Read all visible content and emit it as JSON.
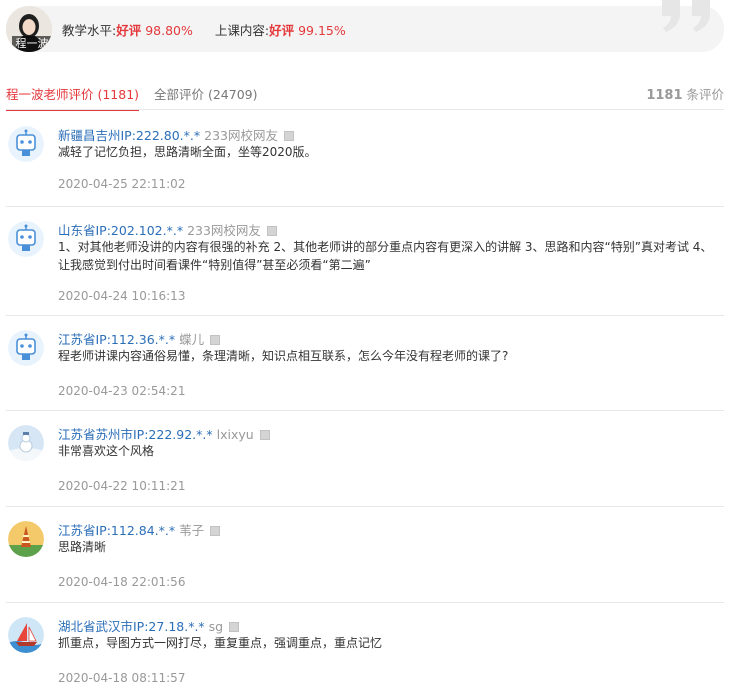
{
  "header": {
    "teacher_name": "程一波",
    "rating_teaching_label": "教学水平:",
    "rating_teaching_good": "好评",
    "rating_teaching_value": "98.80%",
    "rating_content_label": "上课内容:",
    "rating_content_good": "好评",
    "rating_content_value": "99.15%"
  },
  "tabs": [
    {
      "label": "程一波老师评价 (1181)",
      "active": true
    },
    {
      "label": "全部评价 (24709)",
      "active": false
    }
  ],
  "summary": {
    "count": "1181",
    "suffix": " 条评价"
  },
  "reviews": [
    {
      "location": "新疆昌吉州IP:222.80.*.*",
      "user": "233网校网友",
      "text": "减轻了记忆负担，思路清晰全面，坐等2020版。",
      "time": "2020-04-25 22:11:02",
      "avatar": "robot-avatar"
    },
    {
      "location": "山东省IP:202.102.*.*",
      "user": "233网校网友",
      "text": "1、对其他老师没讲的内容有很强的补充 2、其他老师讲的部分重点内容有更深入的讲解 3、思路和内容“特别”真对考试 4、让我感觉到付出时间看课件“特别值得”甚至必须看“第二遍”",
      "time": "2020-04-24 10:16:13",
      "avatar": "robot-avatar"
    },
    {
      "location": "江苏省IP:112.36.*.*",
      "user": "蝶儿",
      "text": "程老师讲课内容通俗易懂，条理清晰，知识点相互联系，怎么今年没有程老师的课了?",
      "time": "2020-04-23 02:54:21",
      "avatar": "robot-avatar"
    },
    {
      "location": "江苏省苏州市IP:222.92.*.*",
      "user": "lxixyu",
      "text": "非常喜欢这个风格",
      "time": "2020-04-22 10:11:21",
      "avatar": "snowman-avatar"
    },
    {
      "location": "江苏省IP:112.84.*.*",
      "user": "苇子",
      "text": "思路清晰",
      "time": "2020-04-18 22:01:56",
      "avatar": "tower-avatar"
    },
    {
      "location": "湖北省武汉市IP:27.18.*.*",
      "user": "sg",
      "text": "抓重点，导图方式一网打尽，重复重点，强调重点，重点记忆",
      "time": "2020-04-18 08:11:57",
      "avatar": "sailboat-avatar"
    }
  ]
}
